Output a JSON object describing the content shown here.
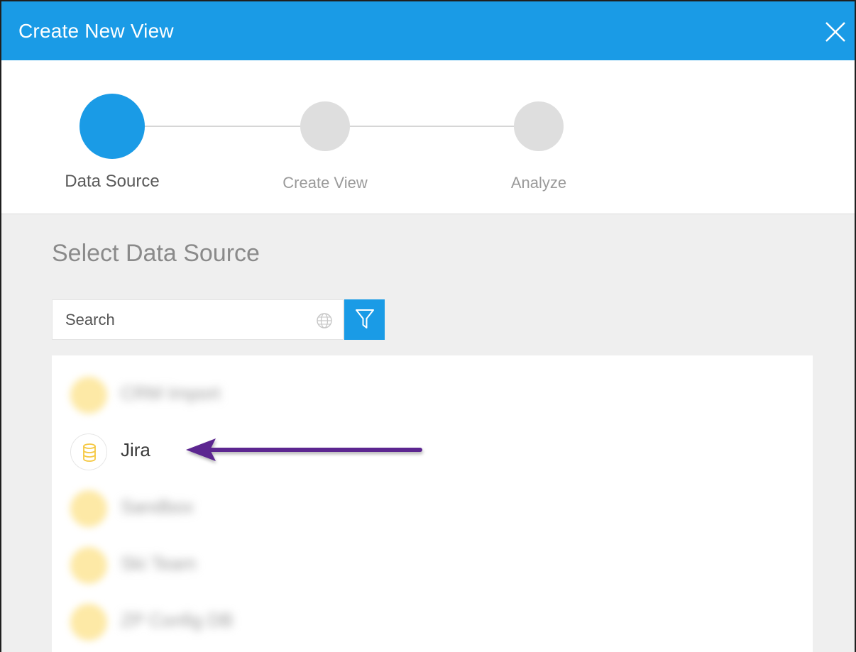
{
  "dialog": {
    "title": "Create New View"
  },
  "stepper": {
    "steps": [
      {
        "label": "Data Source",
        "state": "active"
      },
      {
        "label": "Create View",
        "state": "inactive"
      },
      {
        "label": "Analyze",
        "state": "inactive"
      }
    ]
  },
  "main": {
    "section_title": "Select Data Source",
    "search": {
      "placeholder": "Search",
      "value": ""
    },
    "data_sources": [
      {
        "label": "CRM Import",
        "blurred": true
      },
      {
        "label": "Jira",
        "blurred": false
      },
      {
        "label": "Sandbox",
        "blurred": false
      },
      {
        "label": "Ski Team",
        "blurred": false
      },
      {
        "label": "ZP Config DB",
        "blurred": false
      }
    ]
  },
  "colors": {
    "accent": "#1a9be6",
    "step_inactive": "#dedede",
    "datasource_icon": "#f5c842",
    "annotation_arrow": "#5b2590"
  },
  "icons": {
    "close": "close-icon",
    "globe": "globe-icon",
    "filter": "filter-icon",
    "database": "database-icon",
    "arrow": "annotation-arrow-icon"
  }
}
